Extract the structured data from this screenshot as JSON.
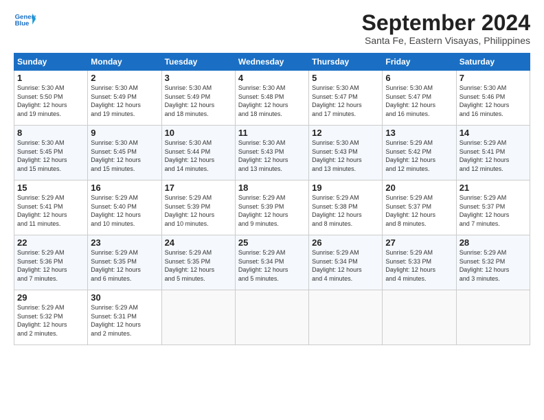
{
  "header": {
    "logo_line1": "General",
    "logo_line2": "Blue",
    "month_title": "September 2024",
    "location": "Santa Fe, Eastern Visayas, Philippines"
  },
  "weekdays": [
    "Sunday",
    "Monday",
    "Tuesday",
    "Wednesday",
    "Thursday",
    "Friday",
    "Saturday"
  ],
  "weeks": [
    [
      {
        "day": "1",
        "info": "Sunrise: 5:30 AM\nSunset: 5:50 PM\nDaylight: 12 hours\nand 19 minutes."
      },
      {
        "day": "2",
        "info": "Sunrise: 5:30 AM\nSunset: 5:49 PM\nDaylight: 12 hours\nand 19 minutes."
      },
      {
        "day": "3",
        "info": "Sunrise: 5:30 AM\nSunset: 5:49 PM\nDaylight: 12 hours\nand 18 minutes."
      },
      {
        "day": "4",
        "info": "Sunrise: 5:30 AM\nSunset: 5:48 PM\nDaylight: 12 hours\nand 18 minutes."
      },
      {
        "day": "5",
        "info": "Sunrise: 5:30 AM\nSunset: 5:47 PM\nDaylight: 12 hours\nand 17 minutes."
      },
      {
        "day": "6",
        "info": "Sunrise: 5:30 AM\nSunset: 5:47 PM\nDaylight: 12 hours\nand 16 minutes."
      },
      {
        "day": "7",
        "info": "Sunrise: 5:30 AM\nSunset: 5:46 PM\nDaylight: 12 hours\nand 16 minutes."
      }
    ],
    [
      {
        "day": "8",
        "info": "Sunrise: 5:30 AM\nSunset: 5:45 PM\nDaylight: 12 hours\nand 15 minutes."
      },
      {
        "day": "9",
        "info": "Sunrise: 5:30 AM\nSunset: 5:45 PM\nDaylight: 12 hours\nand 15 minutes."
      },
      {
        "day": "10",
        "info": "Sunrise: 5:30 AM\nSunset: 5:44 PM\nDaylight: 12 hours\nand 14 minutes."
      },
      {
        "day": "11",
        "info": "Sunrise: 5:30 AM\nSunset: 5:43 PM\nDaylight: 12 hours\nand 13 minutes."
      },
      {
        "day": "12",
        "info": "Sunrise: 5:30 AM\nSunset: 5:43 PM\nDaylight: 12 hours\nand 13 minutes."
      },
      {
        "day": "13",
        "info": "Sunrise: 5:29 AM\nSunset: 5:42 PM\nDaylight: 12 hours\nand 12 minutes."
      },
      {
        "day": "14",
        "info": "Sunrise: 5:29 AM\nSunset: 5:41 PM\nDaylight: 12 hours\nand 12 minutes."
      }
    ],
    [
      {
        "day": "15",
        "info": "Sunrise: 5:29 AM\nSunset: 5:41 PM\nDaylight: 12 hours\nand 11 minutes."
      },
      {
        "day": "16",
        "info": "Sunrise: 5:29 AM\nSunset: 5:40 PM\nDaylight: 12 hours\nand 10 minutes."
      },
      {
        "day": "17",
        "info": "Sunrise: 5:29 AM\nSunset: 5:39 PM\nDaylight: 12 hours\nand 10 minutes."
      },
      {
        "day": "18",
        "info": "Sunrise: 5:29 AM\nSunset: 5:39 PM\nDaylight: 12 hours\nand 9 minutes."
      },
      {
        "day": "19",
        "info": "Sunrise: 5:29 AM\nSunset: 5:38 PM\nDaylight: 12 hours\nand 8 minutes."
      },
      {
        "day": "20",
        "info": "Sunrise: 5:29 AM\nSunset: 5:37 PM\nDaylight: 12 hours\nand 8 minutes."
      },
      {
        "day": "21",
        "info": "Sunrise: 5:29 AM\nSunset: 5:37 PM\nDaylight: 12 hours\nand 7 minutes."
      }
    ],
    [
      {
        "day": "22",
        "info": "Sunrise: 5:29 AM\nSunset: 5:36 PM\nDaylight: 12 hours\nand 7 minutes."
      },
      {
        "day": "23",
        "info": "Sunrise: 5:29 AM\nSunset: 5:35 PM\nDaylight: 12 hours\nand 6 minutes."
      },
      {
        "day": "24",
        "info": "Sunrise: 5:29 AM\nSunset: 5:35 PM\nDaylight: 12 hours\nand 5 minutes."
      },
      {
        "day": "25",
        "info": "Sunrise: 5:29 AM\nSunset: 5:34 PM\nDaylight: 12 hours\nand 5 minutes."
      },
      {
        "day": "26",
        "info": "Sunrise: 5:29 AM\nSunset: 5:34 PM\nDaylight: 12 hours\nand 4 minutes."
      },
      {
        "day": "27",
        "info": "Sunrise: 5:29 AM\nSunset: 5:33 PM\nDaylight: 12 hours\nand 4 minutes."
      },
      {
        "day": "28",
        "info": "Sunrise: 5:29 AM\nSunset: 5:32 PM\nDaylight: 12 hours\nand 3 minutes."
      }
    ],
    [
      {
        "day": "29",
        "info": "Sunrise: 5:29 AM\nSunset: 5:32 PM\nDaylight: 12 hours\nand 2 minutes."
      },
      {
        "day": "30",
        "info": "Sunrise: 5:29 AM\nSunset: 5:31 PM\nDaylight: 12 hours\nand 2 minutes."
      },
      {
        "day": "",
        "info": ""
      },
      {
        "day": "",
        "info": ""
      },
      {
        "day": "",
        "info": ""
      },
      {
        "day": "",
        "info": ""
      },
      {
        "day": "",
        "info": ""
      }
    ]
  ]
}
